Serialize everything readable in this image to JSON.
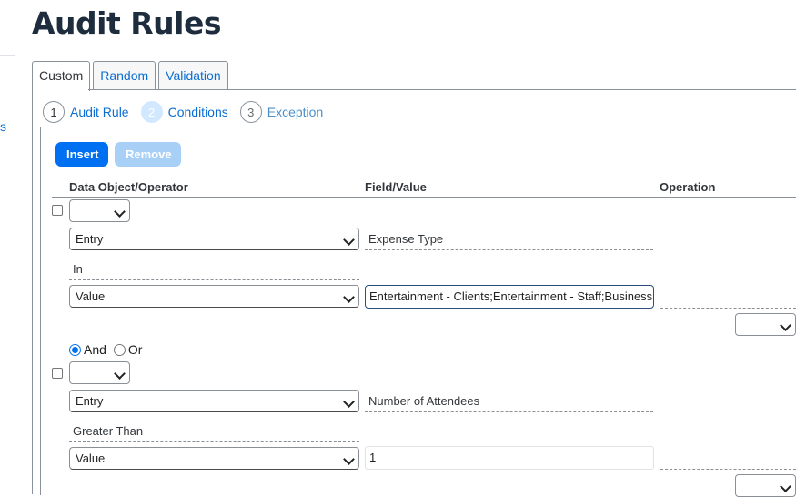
{
  "page": {
    "title": "Audit Rules",
    "sidebar_fragment": "s"
  },
  "tabs": [
    {
      "label": "Custom",
      "active": true
    },
    {
      "label": "Random",
      "active": false
    },
    {
      "label": "Validation",
      "active": false
    }
  ],
  "steps": [
    {
      "num": "1",
      "label": "Audit Rule",
      "state": "done"
    },
    {
      "num": "2",
      "label": "Conditions",
      "state": "current"
    },
    {
      "num": "3",
      "label": "Exception",
      "state": "future"
    }
  ],
  "toolbar": {
    "insert_label": "Insert",
    "remove_label": "Remove"
  },
  "columns": {
    "data_object": "Data Object/Operator",
    "field_value": "Field/Value",
    "operation": "Operation"
  },
  "conditions": [
    {
      "paren_select": "",
      "left_object": "Entry",
      "left_field": "Expense Type",
      "operator": "In",
      "right_object": "Value",
      "right_value": "Entertainment - Clients;Entertainment - Staff;Business",
      "operation_select": ""
    },
    {
      "paren_select": "",
      "left_object": "Entry",
      "left_field": "Number of Attendees",
      "operator": "Greater Than",
      "right_object": "Value",
      "right_value": "1",
      "operation_select": ""
    }
  ],
  "conjunction": {
    "and_label": "And",
    "or_label": "Or",
    "selected": "And"
  }
}
